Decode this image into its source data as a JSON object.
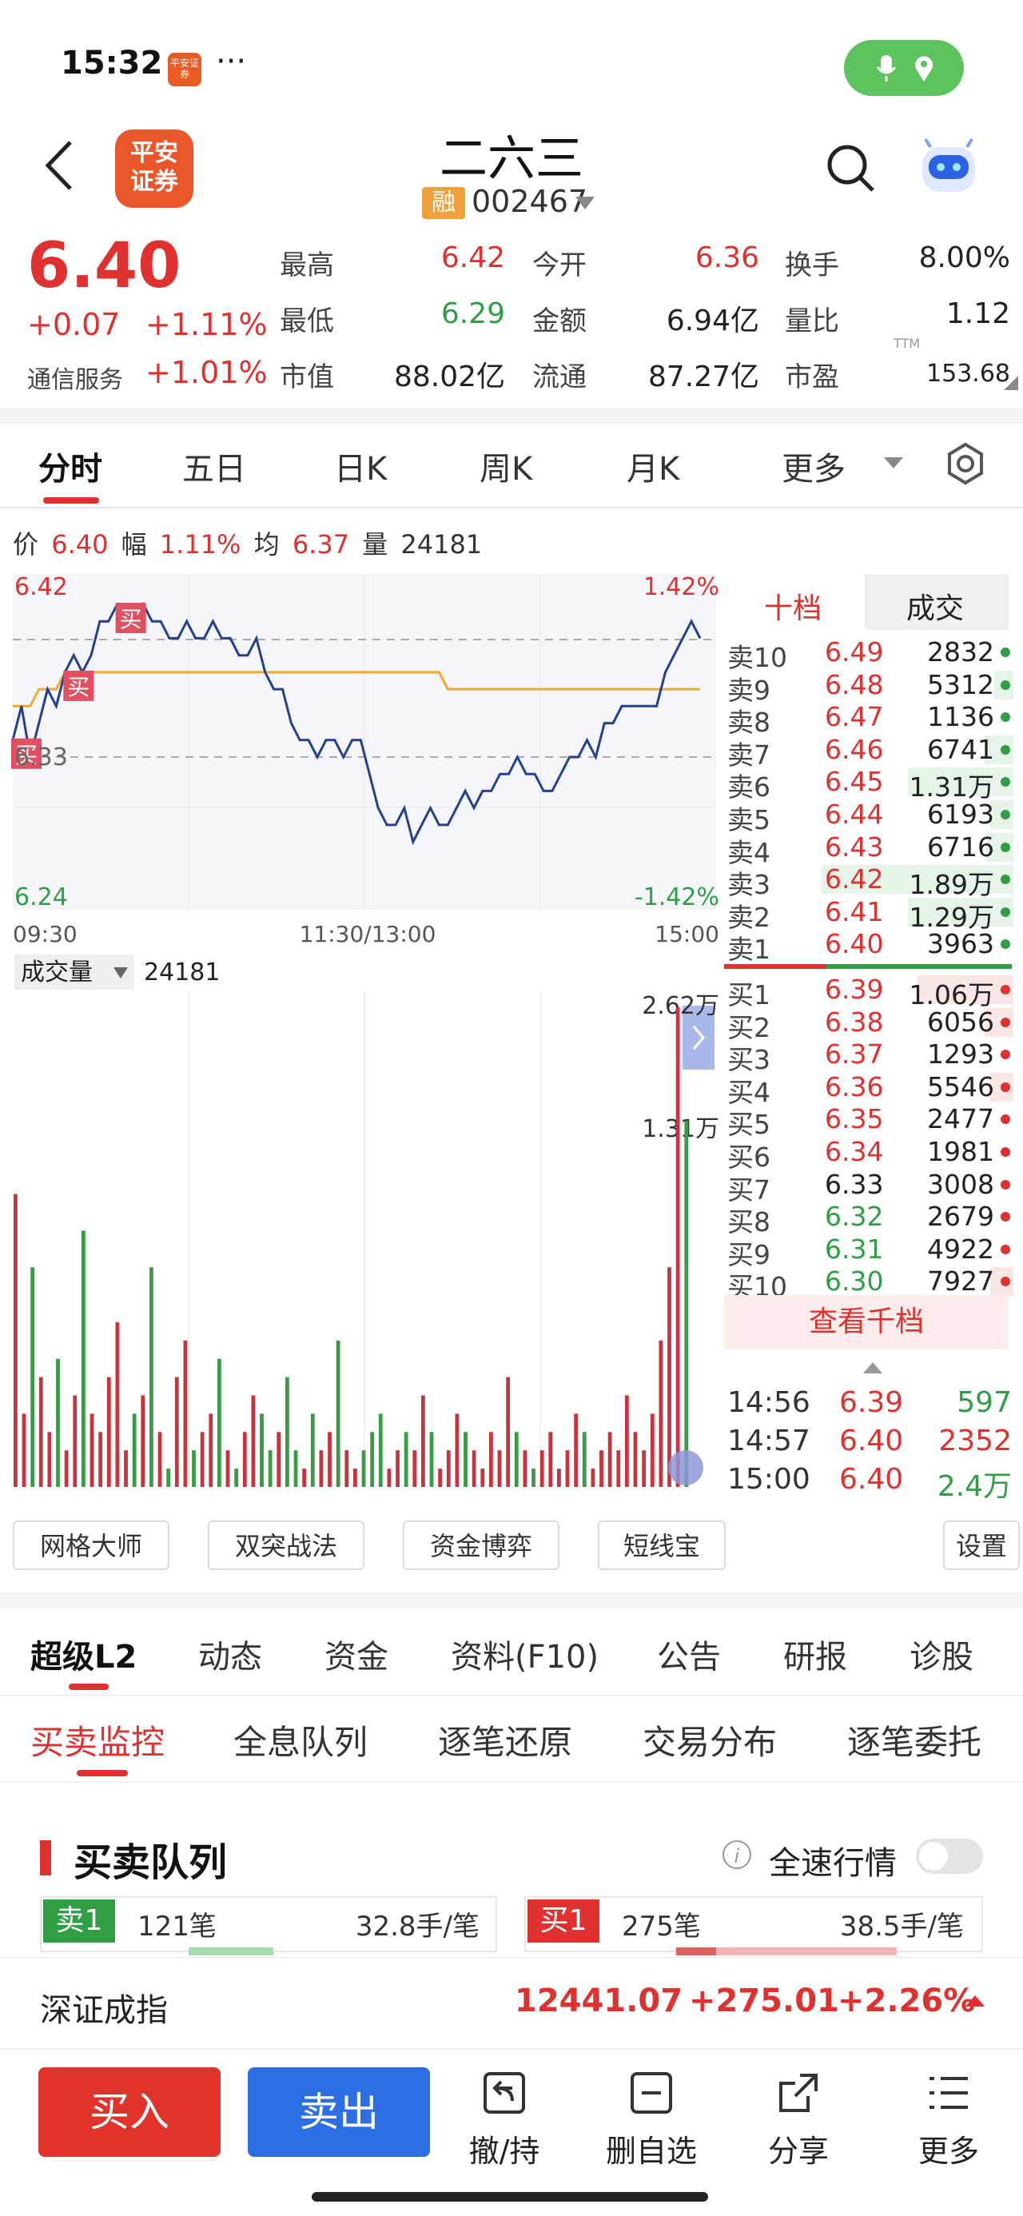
{
  "status_bar": {
    "time": "15:32",
    "app_badge": "平安证券",
    "more": "···"
  },
  "header": {
    "logo_text_line1": "平安",
    "logo_text_line2": "证券",
    "stock_name": "二六三",
    "margin_badge": "融",
    "stock_code": "002467"
  },
  "quote": {
    "price": "6.40",
    "change": "+0.07",
    "change_pct": "+1.11%",
    "sector": "通信服务",
    "sector_pct": "+1.01%",
    "fields": [
      {
        "label": "最高",
        "value": "6.42",
        "color": "red"
      },
      {
        "label": "今开",
        "value": "6.36",
        "color": "red"
      },
      {
        "label": "换手",
        "value": "8.00%",
        "color": "dark"
      },
      {
        "label": "最低",
        "value": "6.29",
        "color": "green"
      },
      {
        "label": "金额",
        "value": "6.94亿",
        "color": "dark"
      },
      {
        "label": "量比",
        "value": "1.12",
        "color": "dark"
      },
      {
        "label": "市值",
        "value": "88.02亿",
        "color": "dark"
      },
      {
        "label": "流通",
        "value": "87.27亿",
        "color": "dark"
      },
      {
        "label": "市盈",
        "value": "153.68",
        "color": "dark"
      }
    ],
    "pe_suffix": "TTM"
  },
  "period_tabs": [
    "分时",
    "五日",
    "日K",
    "周K",
    "月K",
    "更多"
  ],
  "info_line": {
    "price_label": "价",
    "price": "6.40",
    "range_label": "幅",
    "range": "1.11%",
    "avg_label": "均",
    "avg": "6.37",
    "vol_label": "量",
    "vol": "24181"
  },
  "chart_data": {
    "type": "line",
    "title": "",
    "y_axis_labels": {
      "high": "6.42",
      "mid": "6.33",
      "low": "6.24",
      "high_pct": "1.42%",
      "low_pct": "-1.42%"
    },
    "ylim": [
      6.24,
      6.42
    ],
    "prev_close": 6.33,
    "x_labels": [
      "09:30",
      "11:30/13:00",
      "15:00"
    ],
    "markers": [
      "买",
      "买",
      "买"
    ],
    "price_series": [
      6.34,
      6.36,
      6.33,
      6.35,
      6.37,
      6.36,
      6.38,
      6.39,
      6.38,
      6.39,
      6.41,
      6.41,
      6.42,
      6.42,
      6.41,
      6.42,
      6.41,
      6.41,
      6.4,
      6.4,
      6.41,
      6.4,
      6.4,
      6.41,
      6.4,
      6.4,
      6.39,
      6.39,
      6.4,
      6.38,
      6.37,
      6.37,
      6.35,
      6.34,
      6.34,
      6.33,
      6.34,
      6.34,
      6.33,
      6.34,
      6.34,
      6.32,
      6.3,
      6.29,
      6.29,
      6.3,
      6.28,
      6.29,
      6.3,
      6.29,
      6.29,
      6.3,
      6.31,
      6.3,
      6.31,
      6.31,
      6.32,
      6.32,
      6.33,
      6.32,
      6.32,
      6.31,
      6.31,
      6.32,
      6.33,
      6.33,
      6.34,
      6.33,
      6.35,
      6.35,
      6.36,
      6.36,
      6.36,
      6.36,
      6.36,
      6.38,
      6.39,
      6.4,
      6.41,
      6.4
    ],
    "avg_series": [
      6.36,
      6.36,
      6.36,
      6.37,
      6.37,
      6.37,
      6.38,
      6.38,
      6.38,
      6.38,
      6.38,
      6.38,
      6.38,
      6.38,
      6.38,
      6.38,
      6.38,
      6.38,
      6.38,
      6.38,
      6.38,
      6.38,
      6.38,
      6.38,
      6.38,
      6.38,
      6.38,
      6.38,
      6.38,
      6.38,
      6.38,
      6.38,
      6.38,
      6.38,
      6.38,
      6.38,
      6.38,
      6.38,
      6.38,
      6.38,
      6.38,
      6.38,
      6.38,
      6.38,
      6.38,
      6.38,
      6.38,
      6.38,
      6.38,
      6.38,
      6.37,
      6.37,
      6.37,
      6.37,
      6.37,
      6.37,
      6.37,
      6.37,
      6.37,
      6.37,
      6.37,
      6.37,
      6.37,
      6.37,
      6.37,
      6.37,
      6.37,
      6.37,
      6.37,
      6.37,
      6.37,
      6.37,
      6.37,
      6.37,
      6.37,
      6.37,
      6.37,
      6.37,
      6.37,
      6.37
    ],
    "volume_label": "成交量",
    "volume_total": "24181",
    "volume_ticks": [
      "2.62万",
      "1.31万"
    ],
    "volume_ylim": [
      0,
      26200
    ],
    "volume_series": [
      16000,
      4000,
      12000,
      6000,
      3000,
      7000,
      2000,
      5000,
      14000,
      4000,
      3000,
      6000,
      9000,
      2000,
      4000,
      5000,
      12000,
      3000,
      1000,
      6000,
      8000,
      2000,
      3000,
      4000,
      7000,
      2000,
      1000,
      3000,
      5000,
      4000,
      2000,
      3000,
      6000,
      2000,
      1000,
      4000,
      2000,
      3000,
      8000,
      2000,
      1000,
      2000,
      3000,
      4000,
      1000,
      2000,
      3000,
      2000,
      5000,
      3000,
      1000,
      2000,
      4000,
      3000,
      2000,
      1000,
      3000,
      2000,
      6000,
      3000,
      2000,
      1000,
      2000,
      3000,
      1000,
      2000,
      4000,
      3000,
      1000,
      2000,
      3000,
      2000,
      5000,
      3000,
      2000,
      4000,
      8000,
      12000,
      26200,
      20000
    ]
  },
  "order_book": {
    "tab_active": "十档",
    "tab_other": "成交",
    "asks": [
      {
        "label": "卖10",
        "price": "6.49",
        "vol": "2832",
        "bar": 0.0
      },
      {
        "label": "卖9",
        "price": "6.48",
        "vol": "5312",
        "bar": 0.1
      },
      {
        "label": "卖8",
        "price": "6.47",
        "vol": "1136",
        "bar": 0.0
      },
      {
        "label": "卖7",
        "price": "6.46",
        "vol": "6741",
        "bar": 0.15
      },
      {
        "label": "卖6",
        "price": "6.45",
        "vol": "1.31万",
        "bar": 0.55
      },
      {
        "label": "卖5",
        "price": "6.44",
        "vol": "6193",
        "bar": 0.12
      },
      {
        "label": "卖4",
        "price": "6.43",
        "vol": "6716",
        "bar": 0.14
      },
      {
        "label": "卖3",
        "price": "6.42",
        "vol": "1.89万",
        "bar": 1.0
      },
      {
        "label": "卖2",
        "price": "6.41",
        "vol": "1.29万",
        "bar": 0.55
      },
      {
        "label": "卖1",
        "price": "6.40",
        "vol": "3963",
        "bar": 0.0
      }
    ],
    "bids": [
      {
        "label": "买1",
        "price": "6.39",
        "vol": "1.06万",
        "bar": 0.5
      },
      {
        "label": "买2",
        "price": "6.38",
        "vol": "6056",
        "bar": 0.15
      },
      {
        "label": "买3",
        "price": "6.37",
        "vol": "1293",
        "bar": 0.0
      },
      {
        "label": "买4",
        "price": "6.36",
        "vol": "5546",
        "bar": 0.12
      },
      {
        "label": "买5",
        "price": "6.35",
        "vol": "2477",
        "bar": 0.0
      },
      {
        "label": "买6",
        "price": "6.34",
        "vol": "1981",
        "bar": 0.0
      },
      {
        "label": "买7",
        "price": "6.33",
        "vol": "3008",
        "bar": 0.0
      },
      {
        "label": "买8",
        "price": "6.32",
        "vol": "2679",
        "bar": 0.0
      },
      {
        "label": "买9",
        "price": "6.31",
        "vol": "4922",
        "bar": 0.0
      },
      {
        "label": "买10",
        "price": "6.30",
        "vol": "7927",
        "bar": 0.12
      }
    ],
    "more_button": "查看千档",
    "ticks": [
      {
        "time": "14:56",
        "price": "6.39",
        "vol": "597",
        "vol_color": "green"
      },
      {
        "time": "14:57",
        "price": "6.40",
        "vol": "2352",
        "vol_color": "red"
      },
      {
        "time": "15:00",
        "price": "6.40",
        "vol": "2.4万",
        "vol_color": "green"
      }
    ]
  },
  "tools": [
    "网格大师",
    "双突战法",
    "资金博弈",
    "短线宝",
    "设置"
  ],
  "l2_tabs": [
    "超级L2",
    "动态",
    "资金",
    "资料(F10)",
    "公告",
    "研报",
    "诊股"
  ],
  "sub_tabs": [
    "买卖监控",
    "全息队列",
    "逐笔还原",
    "交易分布",
    "逐笔委托"
  ],
  "queue": {
    "title": "买卖队列",
    "info_icon": "i",
    "fullspeed_label": "全速行情",
    "sell": {
      "badge": "卖1",
      "count": "121笔",
      "avg": "32.8手/笔"
    },
    "buy": {
      "badge": "买1",
      "count": "275笔",
      "avg": "38.5手/笔"
    }
  },
  "index_bar": {
    "name": "深证成指",
    "value": "12441.07",
    "change": "+275.01",
    "pct": "+2.26%"
  },
  "bottom_nav": {
    "buy": "买入",
    "sell": "卖出",
    "items": [
      "撤/持",
      "删自选",
      "分享",
      "更多"
    ]
  },
  "colors": {
    "red": "#e03131",
    "green": "#2f9e44",
    "blue_line": "#24408e",
    "avg_line": "#f0a830",
    "buy_btn": "#e0332c",
    "sell_btn": "#2d6fe3"
  }
}
